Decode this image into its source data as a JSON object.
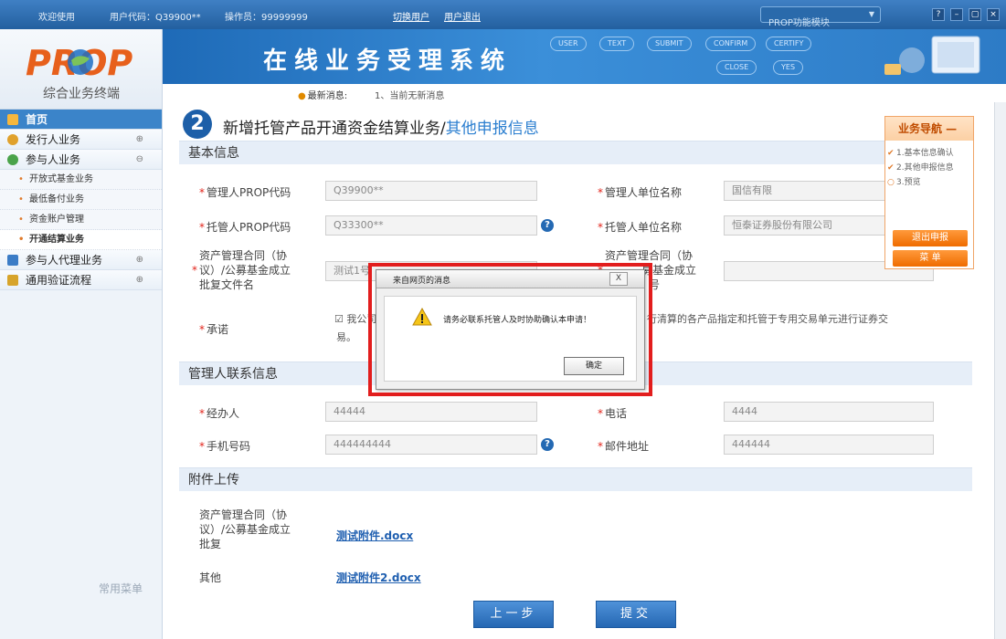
{
  "topbar": {
    "welcome": "欢迎使用",
    "user_code": "用户代码：Q39900**",
    "operator": "操作员：99999999",
    "switch_user": "切换用户",
    "logout": "用户退出",
    "module": "PROP功能模块"
  },
  "sidebar": {
    "logo_text": "PROP",
    "subtitle": "综合业务终端",
    "items": [
      {
        "label": "首页"
      },
      {
        "label": "发行人业务",
        "toggle": "⊕"
      },
      {
        "label": "参与人业务",
        "toggle": "⊖"
      },
      {
        "label": "参与人代理业务",
        "toggle": "⊕"
      },
      {
        "label": "通用验证流程",
        "toggle": "⊕"
      }
    ],
    "subitems": [
      "开放式基金业务",
      "garbled_placeholder",
      "资金账户管理",
      "开通结算业务"
    ],
    "common_menu": "常用菜单"
  },
  "banner": {
    "title": "在线业务受理系统",
    "flow": [
      "USER",
      "TEXT",
      "SUBMIT",
      "CONFIRM",
      "CERTIFY",
      "CLOSE",
      "YES"
    ]
  },
  "news": {
    "label": "最新消息:",
    "message": "1、当前无新消息"
  },
  "page": {
    "step": "2",
    "title_main": "新增托管产品开通资金结算业务/",
    "title_accent": "其他申报信息"
  },
  "basic": {
    "header": "基本信息",
    "manager_code_label": "管理人PROP代码",
    "manager_code": "Q39900**",
    "manager_name_label": "管理人单位名称",
    "manager_name": "国信有限",
    "custodian_code_label": "托管人PROP代码",
    "custodian_code": "Q33300**",
    "custodian_name_label": "托管人单位名称",
    "custodian_name": "恒泰证券股份有限公司",
    "contract_doc_label_1": "资产管理合同（协",
    "contract_doc_label_2": "议）/公募基金成立",
    "contract_doc_label_3": "批复文件名",
    "contract_doc_value": "测试1号",
    "contract_right_label_1": "资产管理合同（协",
    "contract_right_label_2": "募基金成立",
    "contract_right_label_3": "号",
    "promise_label": "承诺",
    "promise_text_1": "☑ 我公司",
    "promise_text_2": "行清算的各产品指定和托管于专用交易单元进行证券交",
    "promise_text_3": "易。"
  },
  "contact": {
    "header": "管理人联系信息",
    "handler_label": "经办人",
    "handler": "44444",
    "phone_label": "电话",
    "phone": "4444",
    "mobile_label": "手机号码",
    "mobile": "444444444",
    "email_label": "邮件地址",
    "email": "444444"
  },
  "attachments": {
    "header": "附件上传",
    "label_1": "资产管理合同（协",
    "label_2": "议）/公募基金成立",
    "label_3": "批复",
    "file_1": "测试附件.docx",
    "other_label": "其他",
    "file_2": "测试附件2.docx"
  },
  "buttons": {
    "prev": "上一步",
    "submit": "提交"
  },
  "right_nav": {
    "title": "业务导航 —",
    "steps": [
      "1.基本信息确认",
      "2.其他申报信息",
      "3.预览"
    ],
    "marks": [
      "✔",
      "✔",
      "○"
    ],
    "exit": "退出申报",
    "menu": "菜   单"
  },
  "dialog": {
    "title": "来自网页的消息",
    "close": "X",
    "message": "请务必联系托管人及时协助确认本申请！",
    "ok": "确定"
  }
}
